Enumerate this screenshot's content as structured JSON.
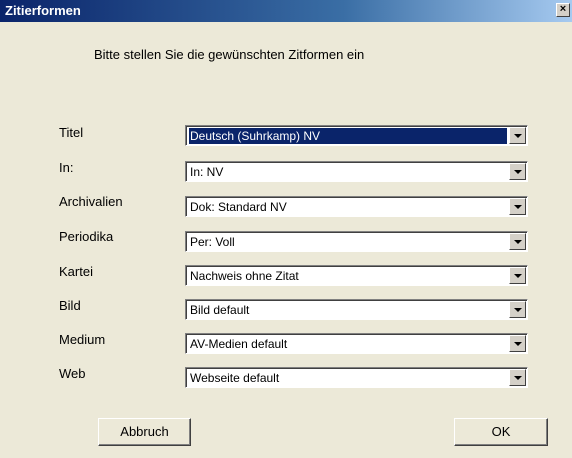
{
  "window": {
    "title": "Zitierformen",
    "close_glyph": "×"
  },
  "instruction": "Bitte stellen Sie die gewünschten Zitformen ein",
  "fields": [
    {
      "label": "Titel",
      "value": "Deutsch (Suhrkamp) NV",
      "selected": true
    },
    {
      "label": "In:",
      "value": "In: NV",
      "selected": false
    },
    {
      "label": "Archivalien",
      "value": "Dok: Standard NV",
      "selected": false
    },
    {
      "label": "Periodika",
      "value": "Per: Voll",
      "selected": false
    },
    {
      "label": "Kartei",
      "value": "Nachweis ohne Zitat",
      "selected": false
    },
    {
      "label": "Bild",
      "value": "Bild default",
      "selected": false
    },
    {
      "label": "Medium",
      "value": "AV-Medien default",
      "selected": false
    },
    {
      "label": "Web",
      "value": "Webseite default",
      "selected": false
    }
  ],
  "buttons": {
    "cancel": "Abbruch",
    "ok": "OK"
  },
  "colors": {
    "titlebar_start": "#0a246a",
    "titlebar_end": "#a6caf0",
    "selection": "#0a246a",
    "dialog_bg": "#ece9d8"
  }
}
